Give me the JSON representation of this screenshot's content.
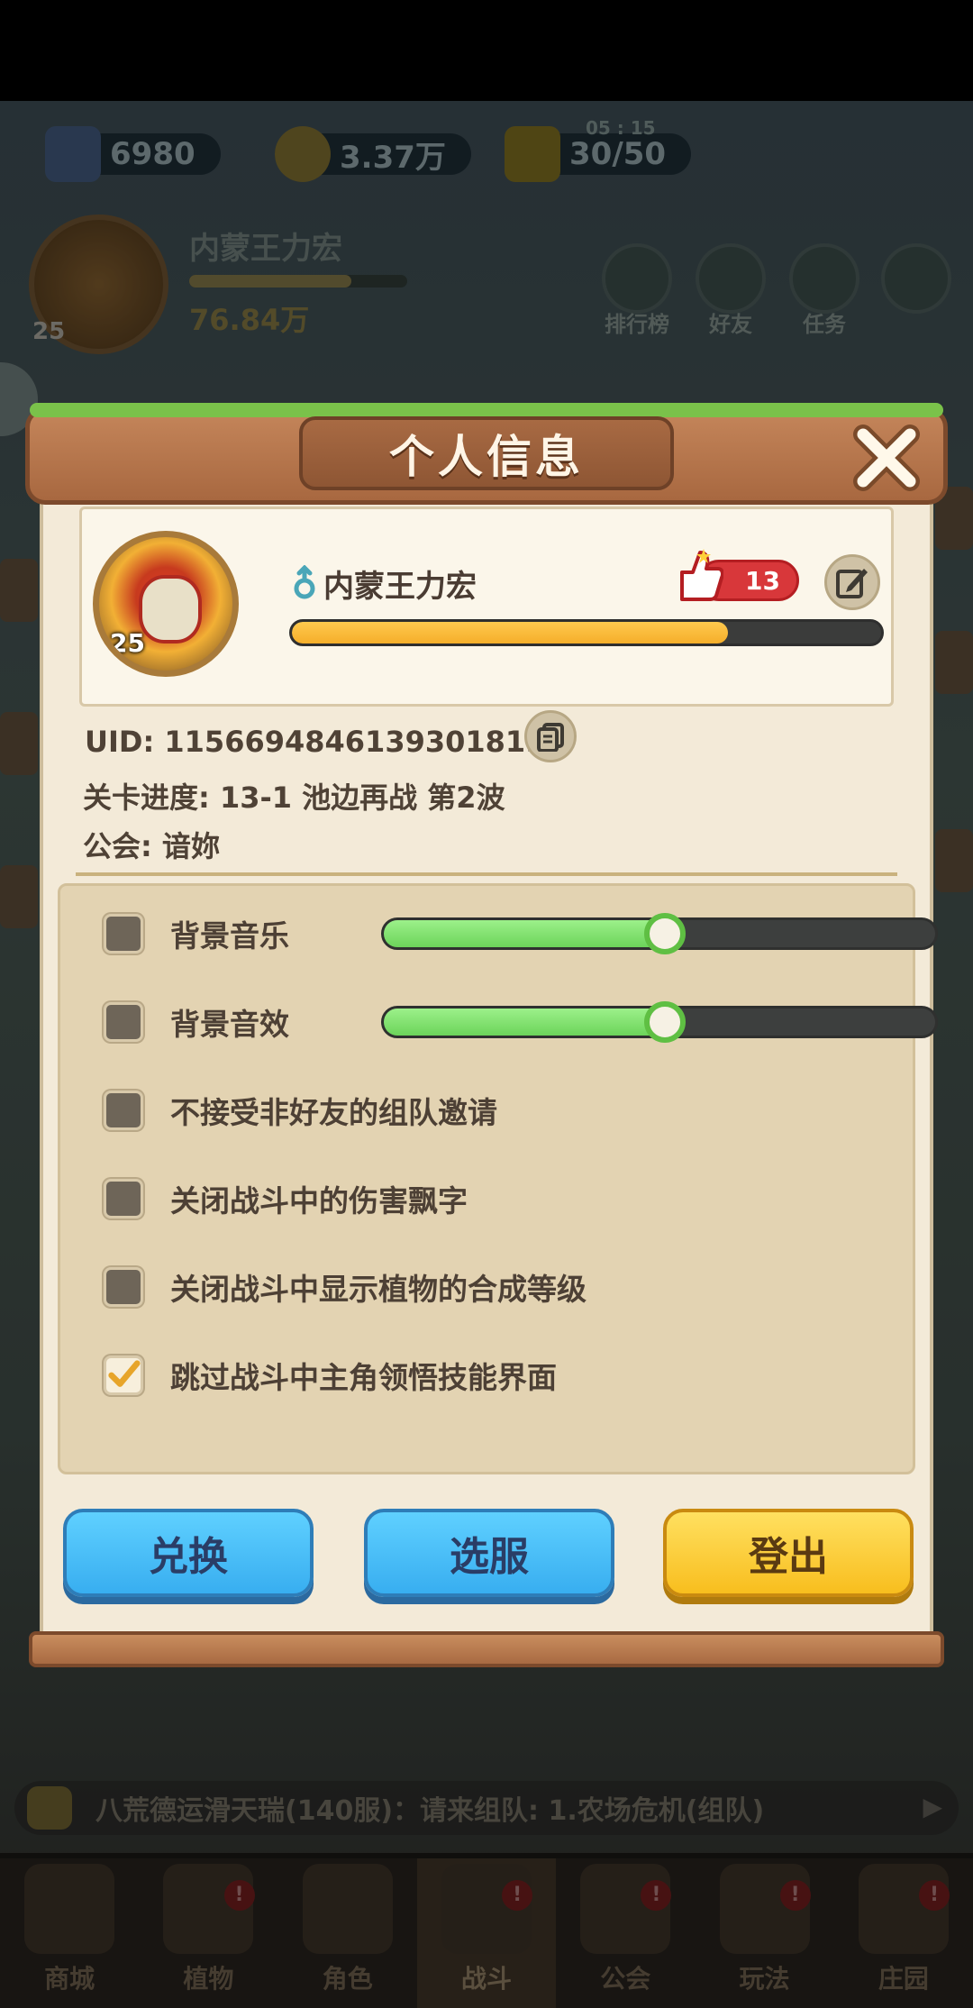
{
  "hud": {
    "diamonds": "6980",
    "gold": "3.37万",
    "energy": "30/50",
    "energy_timer": "05 : 15",
    "player_name": "内蒙王力宏",
    "player_level": "25",
    "power": "76.84万"
  },
  "top_nav": [
    "排行榜",
    "好友",
    "任务"
  ],
  "dialog": {
    "title": "个人信息",
    "profile": {
      "name": "内蒙王力宏",
      "level": "25",
      "likes": "13",
      "xp_progress": 0.74
    },
    "uid": "UID: 1156694846139301819",
    "stage_progress": "关卡进度: 13-1  池边再战 第2波",
    "guild": "公会: 谙妳",
    "settings": {
      "bgm_label": "背景音乐",
      "bgm_volume": 0.51,
      "sfx_label": "背景音效",
      "sfx_volume": 0.51,
      "opt1": "不接受非好友的组队邀请",
      "opt2": "关闭战斗中的伤害飘字",
      "opt3": "关闭战斗中显示植物的合成等级",
      "opt4": "跳过战斗中主角领悟技能界面",
      "opt4_checked": true
    },
    "buttons": {
      "redeem": "兑换",
      "server": "选服",
      "logout": "登出"
    }
  },
  "chat": "八荒德运滑天瑞(140服)：请来组队: 1.农场危机(组队)",
  "bottom_nav": [
    "商城",
    "植物",
    "角色",
    "战斗",
    "公会",
    "玩法",
    "庄园"
  ],
  "colors": {
    "accent_blue": "#38aef0",
    "accent_yellow": "#f8be1e",
    "slider_green": "#6cd45a",
    "xp_orange": "#f5ae2a"
  }
}
